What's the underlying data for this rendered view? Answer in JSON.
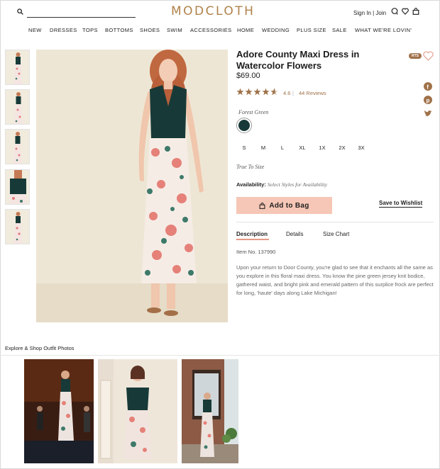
{
  "header": {
    "logo": "MODCLOTH",
    "account": "Sign In | Join",
    "icons": [
      "search-icon",
      "chat-icon",
      "heart-icon",
      "bag-icon"
    ]
  },
  "nav": {
    "items": [
      "NEW",
      "DRESSES",
      "TOPS",
      "BOTTOMS",
      "SHOES",
      "SWIM",
      "ACCESSORIES",
      "HOME",
      "WEDDING",
      "PLUS SIZE",
      "SALE",
      "WHAT WE'RE LOVIN'"
    ]
  },
  "product": {
    "title": "Adore County Maxi Dress in Watercolor Flowers",
    "price": "$69.00",
    "badge": "RTS",
    "rating_value": 4.6,
    "rating_text": "4.6",
    "rating_sep": "|",
    "reviews": "44 Reviews",
    "color_name": "Forest Green",
    "sizes": [
      "S",
      "M",
      "L",
      "XL",
      "1X",
      "2X",
      "3X"
    ],
    "fit": "True To Size",
    "availability_label": "Availability:",
    "availability_value": "Select Styles for Availability",
    "add_to_bag": "Add to Bag",
    "wishlist": "Save to Wishlist",
    "tabs": [
      "Description",
      "Details",
      "Size Chart"
    ],
    "item_no": "Item No. 137990",
    "description": "Upon your return to Door County, you're glad to see that it enchants all the same as you explore in this floral maxi dress. You know the pine green jersey knit bodice, gathered waist, and bright pink and emerald pattern of this surplice frock are perfect for long, 'haute' days along Lake Michigan!"
  },
  "social_icons": [
    "facebook-icon",
    "pinterest-icon",
    "twitter-icon"
  ],
  "outfits": {
    "title": "Explore & Shop Outfit Photos"
  },
  "colors": {
    "brand": "#b0824a",
    "accent_pink": "#f6c7b6",
    "bodice_green": "#173a38",
    "link_brown": "#a0724a"
  }
}
